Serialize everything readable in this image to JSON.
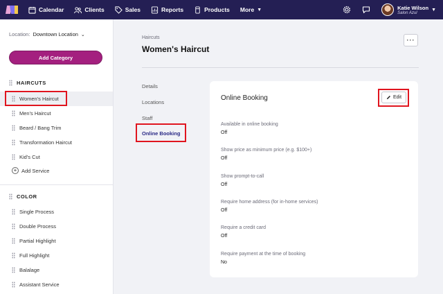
{
  "nav": {
    "items": [
      {
        "label": "Calendar",
        "icon": "calendar-icon"
      },
      {
        "label": "Clients",
        "icon": "clients-icon"
      },
      {
        "label": "Sales",
        "icon": "sales-tag-icon"
      },
      {
        "label": "Reports",
        "icon": "reports-icon"
      },
      {
        "label": "Products",
        "icon": "products-icon"
      },
      {
        "label": "More",
        "icon": "chevron-down-icon"
      }
    ],
    "user": {
      "name": "Katie Wilson",
      "salon": "Salon Azul"
    },
    "brand_color": "#241f54"
  },
  "sidebar": {
    "location_label": "Location:",
    "location_value": "Downtown Location",
    "add_category_label": "Add Category",
    "categories": [
      {
        "name": "HAIRCUTS",
        "services": [
          "Women's Haircut",
          "Men's Haircut",
          "Beard / Bang Trim",
          "Transformation Haircut",
          "Kid's Cut"
        ],
        "add_service_label": "Add Service"
      },
      {
        "name": "COLOR",
        "services": [
          "Single Process",
          "Double Process",
          "Partial Highlight",
          "Full Highlight",
          "Balalage",
          "Assistant Service"
        ]
      }
    ],
    "accent_color": "#a4207f"
  },
  "main": {
    "breadcrumb": "Haircuts",
    "title": "Women's Haircut",
    "more_label": "···",
    "subnav": [
      "Details",
      "Locations",
      "Staff",
      "Online Booking"
    ],
    "active_subnav": "Online Booking"
  },
  "card": {
    "title": "Online Booking",
    "edit_label": "Edit",
    "settings": [
      {
        "label": "Available in online booking",
        "value": "Off"
      },
      {
        "label": "Show price as minimum price (e.g. $100+)",
        "value": "Off"
      },
      {
        "label": "Show prompt-to-call",
        "value": "Off"
      },
      {
        "label": "Require home address (for in-home services)",
        "value": "Off"
      },
      {
        "label": "Require a credit card",
        "value": "Off"
      },
      {
        "label": "Require payment at the time of booking",
        "value": "No"
      }
    ]
  },
  "highlight_color": "#e0141e"
}
